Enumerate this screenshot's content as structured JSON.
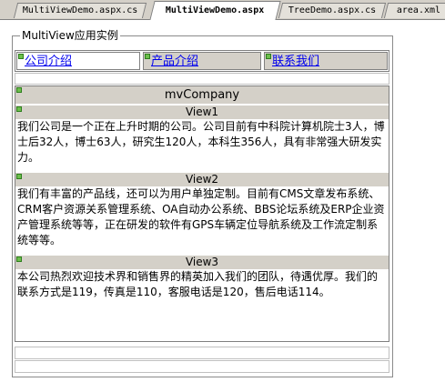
{
  "tabs": [
    {
      "label": "MultiViewDemo.aspx.cs"
    },
    {
      "label": "MultiViewDemo.aspx"
    },
    {
      "label": "TreeDemo.aspx.cs"
    },
    {
      "label": "area.xml"
    }
  ],
  "active_tab": "MultiViewDemo.aspx",
  "fieldset": {
    "legend": "MultiView应用实例"
  },
  "menu": {
    "items": [
      {
        "label": "公司介绍"
      },
      {
        "label": "产品介绍"
      },
      {
        "label": "联系我们"
      }
    ]
  },
  "multiview": {
    "title": "mvCompany",
    "views": [
      {
        "name": "View1",
        "text": "我们公司是一个正在上升时期的公司。公司目前有中科院计算机院士3人，博士后32人，博士63人，研究生120人，本科生356人，具有非常强大研发实力。"
      },
      {
        "name": "View2",
        "text": "我们有丰富的产品线，还可以为用户单独定制。目前有CMS文章发布系统、CRM客户资源关系管理系统、OA自动办公系统、BBS论坛系统及ERP企业资产管理系统等等，正在研发的软件有GPS车辆定位导航系统及工作流定制系统等等。"
      },
      {
        "name": "View3",
        "text": "本公司热烈欢迎技术界和销售界的精英加入我们的团队，待遇优厚。我们的联系方式是119，传真是110，客服电话是120，售后电话114。"
      }
    ]
  },
  "colors": {
    "control_face": "#d4d0c8",
    "link": "#0000ee",
    "glyph": "#6dbf4c"
  }
}
